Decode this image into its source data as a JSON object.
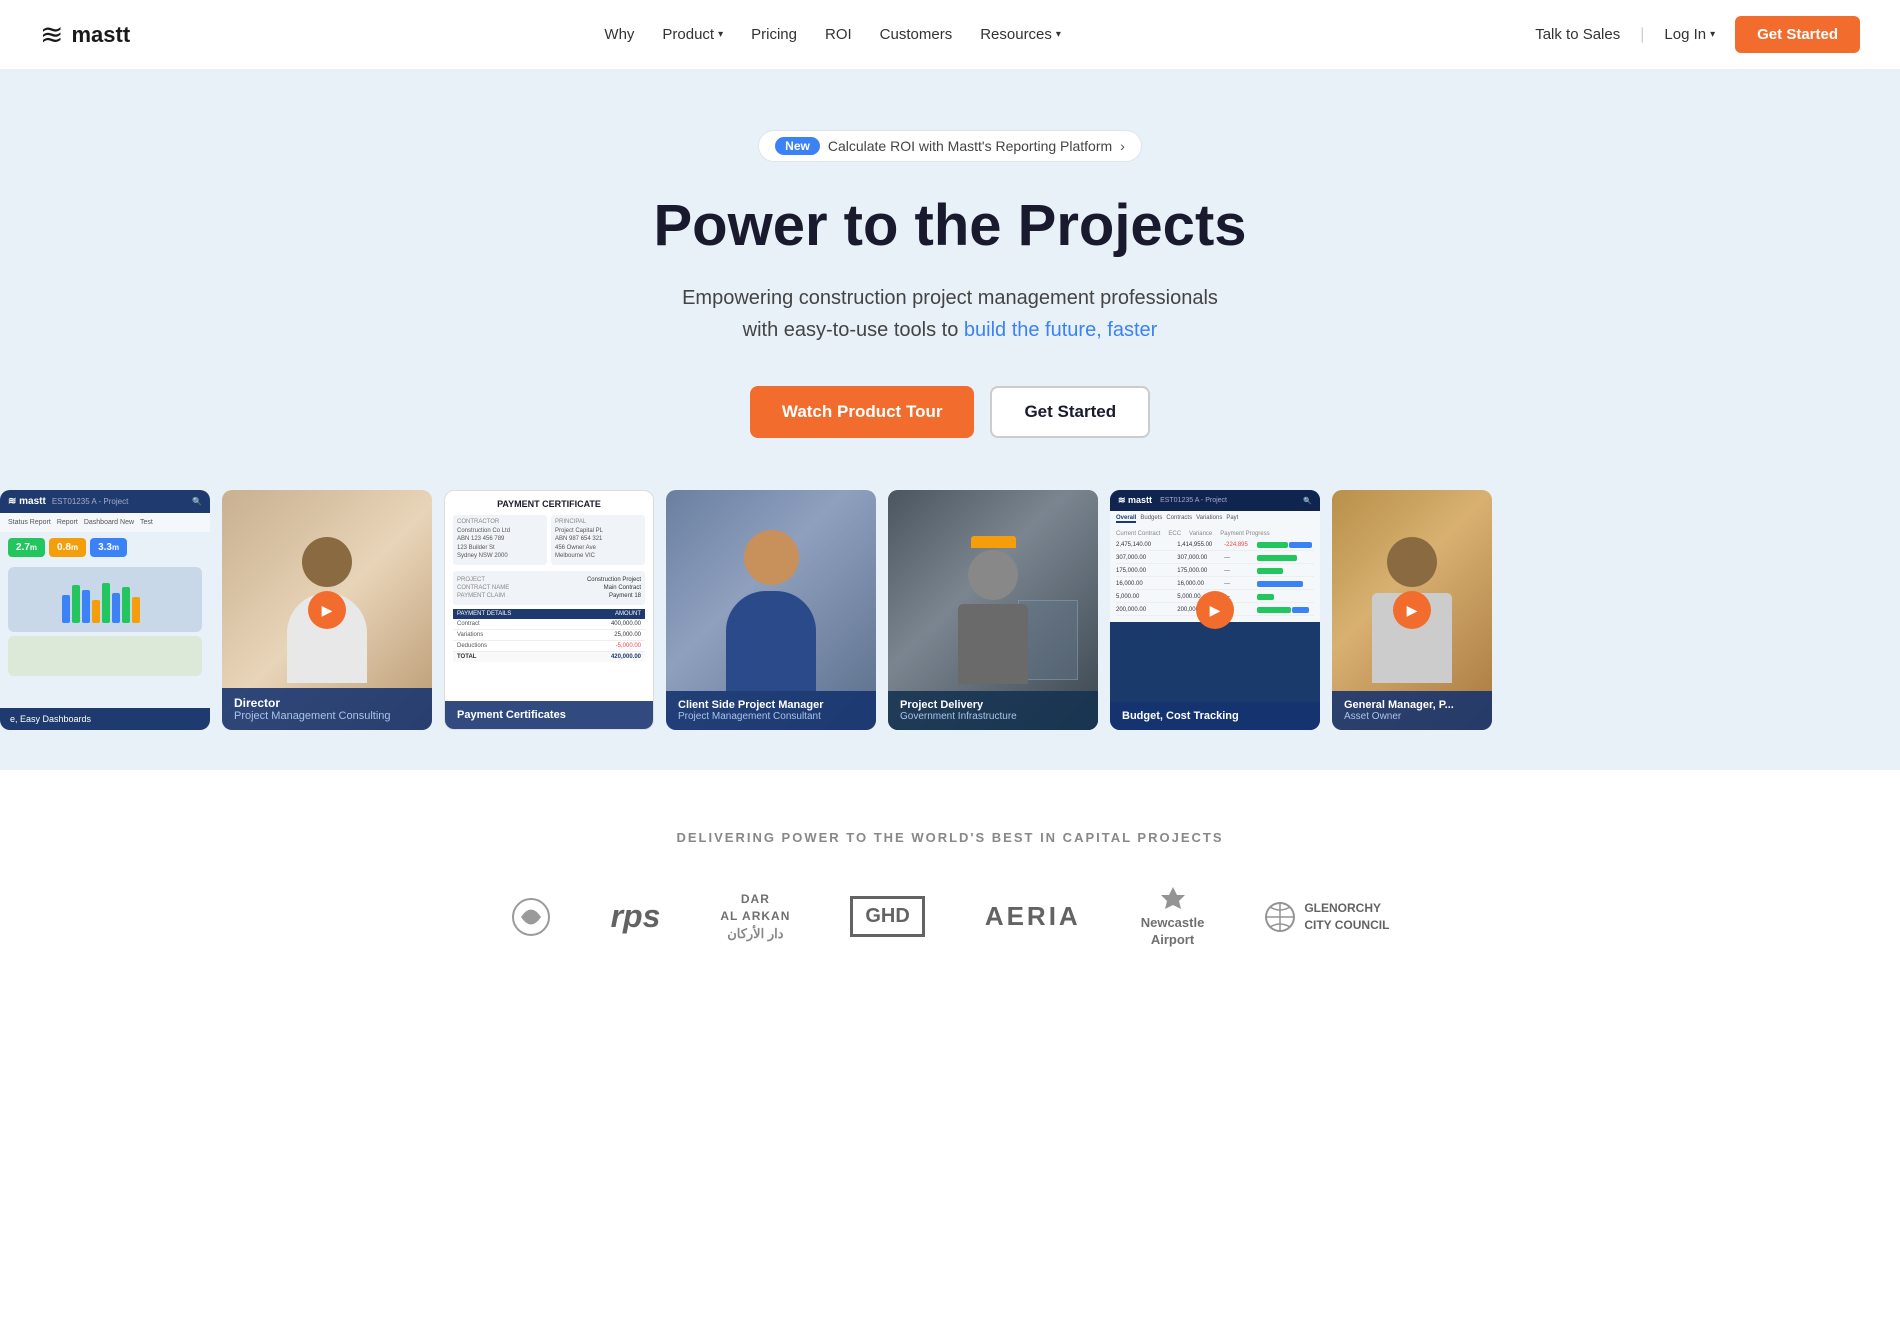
{
  "nav": {
    "logo": "mastt",
    "links": [
      {
        "label": "Why",
        "hasDropdown": false
      },
      {
        "label": "Product",
        "hasDropdown": true
      },
      {
        "label": "Pricing",
        "hasDropdown": false
      },
      {
        "label": "ROI",
        "hasDropdown": false
      },
      {
        "label": "Customers",
        "hasDropdown": false
      },
      {
        "label": "Resources",
        "hasDropdown": true
      }
    ],
    "talk_to_sales": "Talk to Sales",
    "log_in": "Log In",
    "get_started": "Get Started"
  },
  "hero": {
    "badge_new": "New",
    "badge_text": "Calculate ROI with Mastt's Reporting Platform",
    "badge_arrow": "›",
    "title": "Power to the Projects",
    "subtitle_before": "Empowering construction project management professionals\nwith easy-to-use tools to ",
    "subtitle_highlight": "build the future, faster",
    "watch_btn": "Watch Product Tour",
    "started_btn": "Get Started"
  },
  "cards": [
    {
      "id": "dashboard",
      "type": "ui",
      "label": "",
      "sublabel": "e, Easy Dashboards",
      "hasPlay": false
    },
    {
      "id": "director",
      "type": "photo",
      "label": "Director",
      "sublabel": "Project Management Consulting",
      "hasPlay": true
    },
    {
      "id": "payment",
      "type": "ui",
      "label": "",
      "sublabel": "Payment Certificates",
      "hasPlay": false
    },
    {
      "id": "pm",
      "type": "photo",
      "label": "Client Side Project Manager",
      "sublabel": "Project Management Consultant",
      "hasPlay": false
    },
    {
      "id": "infra",
      "type": "photo",
      "label": "Project Delivery",
      "sublabel": "Government Infrastructure",
      "hasPlay": false
    },
    {
      "id": "budget",
      "type": "ui",
      "label": "",
      "sublabel": "Budget, Cost Tracking",
      "hasPlay": true
    },
    {
      "id": "general",
      "type": "photo",
      "label": "General Manager, P...",
      "sublabel": "Asset Owner",
      "hasPlay": true
    }
  ],
  "logos_section": {
    "title": "DELIVERING POWER TO THE WORLD'S BEST IN CAPITAL PROJECTS",
    "logos": [
      {
        "name": "rps",
        "display": "rps"
      },
      {
        "name": "dar-al-arkan",
        "display": "DAR\nAL ARKAN\nدار الأركان"
      },
      {
        "name": "ghd",
        "display": "GHD"
      },
      {
        "name": "aeria",
        "display": "AERIA"
      },
      {
        "name": "newcastle-airport",
        "display": "Newcastle Airport"
      },
      {
        "name": "glenorchy",
        "display": "GLENORCHY\nCITY COUNCIL"
      }
    ]
  }
}
